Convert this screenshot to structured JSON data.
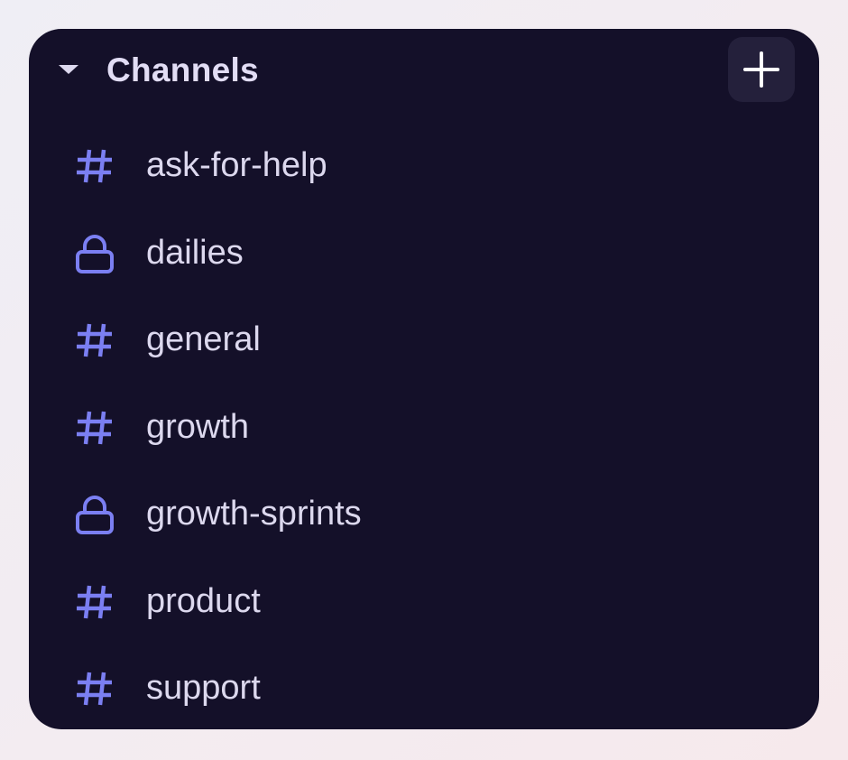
{
  "section": {
    "title": "Channels",
    "collapse_icon": "caret-down-icon",
    "add_icon": "plus-icon"
  },
  "channels": [
    {
      "label": "ask-for-help",
      "icon": "hash-icon"
    },
    {
      "label": "dailies",
      "icon": "lock-icon"
    },
    {
      "label": "general",
      "icon": "hash-icon"
    },
    {
      "label": "growth",
      "icon": "hash-icon"
    },
    {
      "label": "growth-sprints",
      "icon": "lock-icon"
    },
    {
      "label": "product",
      "icon": "hash-icon"
    },
    {
      "label": "support",
      "icon": "hash-icon"
    }
  ],
  "colors": {
    "panel_bg": "#141029",
    "icon_accent": "#7b7ff2",
    "text": "#dcd8ee",
    "button_bg": "#24203b"
  }
}
